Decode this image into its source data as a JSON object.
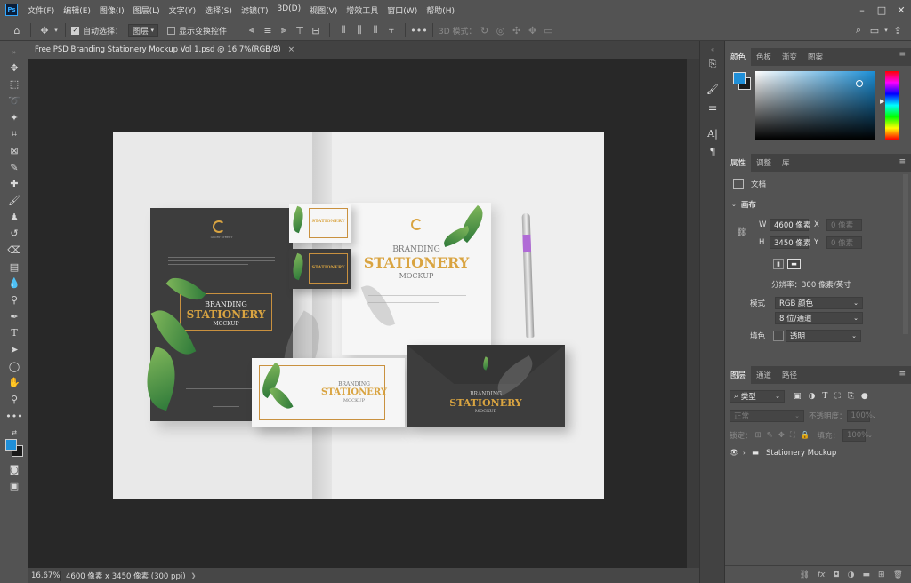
{
  "app": {
    "logo": "Ps"
  },
  "menubar": {
    "items": [
      "文件(F)",
      "编辑(E)",
      "图像(I)",
      "图层(L)",
      "文字(Y)",
      "选择(S)",
      "滤镜(T)",
      "3D(D)",
      "视图(V)",
      "增效工具",
      "窗口(W)",
      "帮助(H)"
    ]
  },
  "window_controls": {
    "minimize": "–",
    "maximize": "□",
    "close": "✕"
  },
  "options": {
    "auto_select_label": "自动选择：",
    "auto_select_checked": true,
    "auto_select_target": "图层",
    "show_transform_label": "显示变换控件",
    "mode_3d_label": "3D 模式："
  },
  "document": {
    "tab_title": "Free PSD Branding Stationery Mockup Vol 1.psd @ 16.7%(RGB/8)",
    "tab_close": "×"
  },
  "status": {
    "zoom": "16.67%",
    "doc_info": "4600 像素 x 3450 像素 (300 ppi)",
    "arrow": "❯"
  },
  "color_panel": {
    "tabs": [
      "颜色",
      "色板",
      "渐变",
      "图案"
    ],
    "active_tab": "颜色",
    "foreground": "#1f8fd8",
    "background": "#1a1a1a",
    "hue_color": "#1c8fd6"
  },
  "properties_panel": {
    "tabs": [
      "属性",
      "调整",
      "库"
    ],
    "active_tab": "属性",
    "kind": "文档",
    "section": "画布",
    "width_label": "W",
    "width_value": "4600 像素",
    "x_label": "X",
    "x_value": "0 像素",
    "height_label": "H",
    "height_value": "3450 像素",
    "y_label": "Y",
    "y_value": "0 像素",
    "resolution": "分辨率：300 像素/英寸",
    "mode_label": "模式",
    "mode_value": "RGB 颜色",
    "depth_value": "8 位/通道",
    "fill_label": "填色",
    "fill_value": "透明"
  },
  "layers_panel": {
    "tabs": [
      "图层",
      "通道",
      "路径"
    ],
    "active_tab": "图层",
    "filter_kind": "类型",
    "blend_mode": "正常",
    "opacity_label": "不透明度：",
    "opacity_value": "100%",
    "lock_label": "锁定：",
    "fill_label": "填充：",
    "fill_value": "100%",
    "layers": [
      {
        "name": "Stationery Mockup",
        "type": "group",
        "visible": true
      }
    ],
    "bottom_icons": [
      "link-icon",
      "fx-icon",
      "mask-icon",
      "adjustment-icon",
      "group-icon",
      "new-layer-icon",
      "delete-icon"
    ]
  },
  "mockup": {
    "brand_small": "GLORY STREET",
    "line1": "BRANDING",
    "line2": "STATIONERY",
    "line3": "MOCKUP"
  }
}
